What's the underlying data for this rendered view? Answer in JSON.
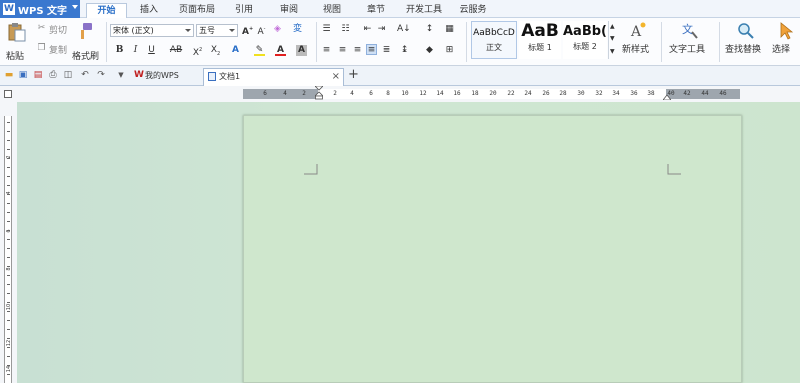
{
  "app": {
    "title": "WPS 文字",
    "logo_letter": "W"
  },
  "menu_tabs": [
    {
      "label": "开始",
      "active": true
    },
    {
      "label": "插入"
    },
    {
      "label": "页面布局"
    },
    {
      "label": "引用"
    },
    {
      "label": "审阅"
    },
    {
      "label": "视图"
    },
    {
      "label": "章节"
    },
    {
      "label": "开发工具"
    },
    {
      "label": "云服务"
    }
  ],
  "ribbon": {
    "paste_label": "粘贴",
    "cut_label": "剪切",
    "copy_label": "复制",
    "format_painter_label": "格式刷",
    "font_name": "宋体 (正文)",
    "font_size": "五号",
    "styles": [
      {
        "preview": "AaBbCcD",
        "label": "正文"
      },
      {
        "preview": "AaB",
        "label": "标题 1"
      },
      {
        "preview": "AaBb(",
        "label": "标题 2"
      }
    ],
    "new_style_label": "新样式",
    "text_tools_label": "文字工具",
    "find_replace_label": "查找替换",
    "select_label": "选择"
  },
  "doc_tabs": [
    {
      "label": "我的WPS",
      "active": false
    },
    {
      "label": "文档1",
      "active": true
    }
  ],
  "ruler": {
    "numbers": [
      "6",
      "4",
      "2",
      "2",
      "4",
      "6",
      "8",
      "10",
      "12",
      "14",
      "16",
      "18",
      "20",
      "22",
      "24",
      "26",
      "28",
      "30",
      "32",
      "34",
      "36",
      "38",
      "40",
      "42",
      "44",
      "46"
    ]
  },
  "vruler": {
    "numbers": [
      "2",
      "4",
      "6",
      "8",
      "10",
      "12",
      "14"
    ]
  },
  "colors": {
    "accent": "#3a78cf",
    "workspace": "#cde5cf",
    "page": "#cfe7cd"
  }
}
